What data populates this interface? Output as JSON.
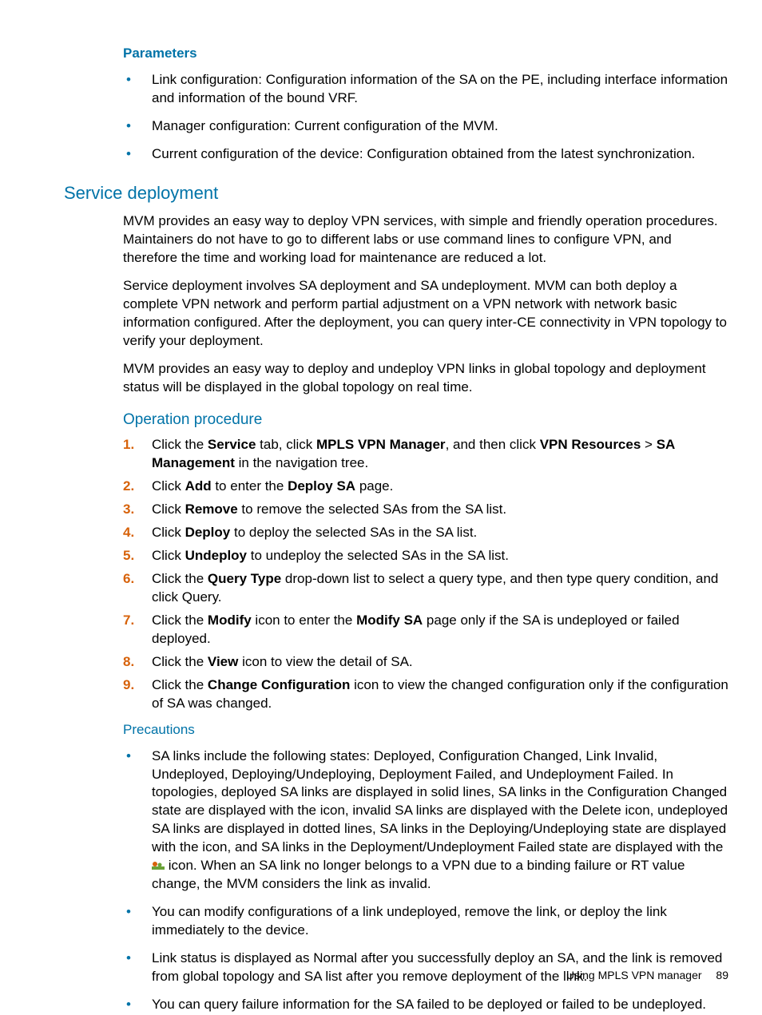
{
  "parameters": {
    "heading": "Parameters",
    "items": [
      "Link configuration: Configuration information of the SA on the PE, including interface information and information of the bound VRF.",
      "Manager configuration: Current configuration of the MVM.",
      "Current configuration of the device: Configuration obtained from the latest synchronization."
    ]
  },
  "service_deployment": {
    "heading": "Service deployment",
    "paras": [
      "MVM provides an easy way to deploy VPN services, with simple and friendly operation procedures. Maintainers do not have to go to different labs or use command lines to configure VPN, and therefore the time and working load for maintenance are reduced a lot.",
      "Service deployment involves SA deployment and SA undeployment. MVM can both deploy a complete VPN network and perform partial adjustment on a VPN network with network basic information configured. After the deployment, you can query inter-CE connectivity in VPN topology to verify your deployment.",
      "MVM provides an easy way to deploy and undeploy VPN links in global topology and deployment status will be displayed in the global topology on real time."
    ]
  },
  "operation_procedure": {
    "heading": "Operation procedure",
    "steps": [
      {
        "pre": "Click the ",
        "b1": "Service",
        "mid1": " tab, click ",
        "b2": "MPLS VPN Manager",
        "mid2": ", and then click ",
        "b3": "VPN Resources",
        "mid3": " > ",
        "b4": "SA Management",
        "post": " in the navigation tree."
      },
      {
        "pre": "Click ",
        "b1": "Add",
        "mid1": " to enter the ",
        "b2": "Deploy SA",
        "post": " page."
      },
      {
        "pre": "Click ",
        "b1": "Remove",
        "post": " to remove the selected SAs from the SA list."
      },
      {
        "pre": "Click ",
        "b1": "Deploy",
        "post": " to deploy the selected SAs in the SA list."
      },
      {
        "pre": "Click ",
        "b1": "Undeploy",
        "post": " to undeploy the selected SAs in the SA list."
      },
      {
        "pre": "Click the ",
        "b1": "Query Type",
        "post": " drop-down list to select a query type, and then type query condition, and click Query."
      },
      {
        "pre": "Click the ",
        "b1": "Modify",
        "mid1": " icon to enter the ",
        "b2": "Modify SA",
        "post": " page only if the SA is undeployed or failed deployed."
      },
      {
        "pre": "Click the ",
        "b1": "View",
        "post": " icon to view the detail of SA."
      },
      {
        "pre": "Click the ",
        "b1": "Change Configuration",
        "post": " icon to view the changed configuration only if the configuration of SA was changed."
      }
    ]
  },
  "precautions": {
    "heading": "Precautions",
    "items": [
      {
        "pre": "SA links include the following states: Deployed, Configuration Changed, Link Invalid, Undeployed, Deploying/Undeploying, Deployment Failed, and Undeployment Failed. In topologies, deployed SA links are displayed in solid lines, SA links in the Configuration Changed state are displayed with the icon, invalid SA links are displayed with the Delete icon, undeployed SA links are displayed in dotted lines, SA links in the Deploying/Undeploying state are displayed with the icon, and SA links in the Deployment/Undeployment Failed state are displayed with the ",
        "icon": true,
        "post": " icon. When an SA link no longer belongs to a VPN due to a binding failure or RT value change, the MVM considers the link as invalid."
      },
      {
        "pre": "You can modify configurations of a link undeployed, remove the link, or deploy the link immediately to the device."
      },
      {
        "pre": "Link status is displayed as Normal after you successfully deploy an SA, and the link is removed from global topology and SA list after you remove deployment of the link."
      },
      {
        "pre": "You can query failure information for the SA failed to be deployed or failed to be undeployed."
      }
    ]
  },
  "footer": {
    "text": "Using MPLS VPN manager",
    "page": "89"
  }
}
